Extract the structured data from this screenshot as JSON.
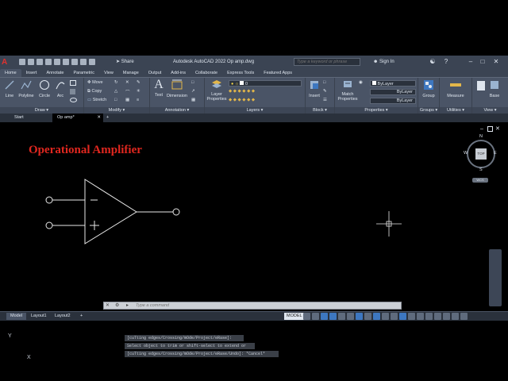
{
  "app": {
    "title": "Autodesk AutoCAD 2022    Op amp.dwg",
    "share_label": "Share",
    "search_placeholder": "Type a keyword or phrase",
    "signin_label": "Sign In",
    "logo_letter": "A"
  },
  "menu": {
    "tabs": [
      "Home",
      "Insert",
      "Annotate",
      "Parametric",
      "View",
      "Manage",
      "Output",
      "Add-ins",
      "Collaborate",
      "Express Tools",
      "Featured Apps"
    ]
  },
  "ribbon": {
    "draw": {
      "title": "Draw",
      "line": "Line",
      "polyline": "Polyline",
      "circle": "Circle",
      "arc": "Arc"
    },
    "modify": {
      "title": "Modify",
      "move": "Move",
      "copy": "Copy",
      "stretch": "Stretch"
    },
    "annotation": {
      "title": "Annotation",
      "text": "Text",
      "dimension": "Dimension"
    },
    "layers": {
      "title": "Layers",
      "layer_properties_1": "Layer",
      "layer_properties_2": "Properties",
      "current_layer": "0"
    },
    "block": {
      "title": "Block",
      "insert": "Insert"
    },
    "properties": {
      "title": "Properties",
      "match_1": "Match",
      "match_2": "Properties",
      "bylayer_color": "ByLayer",
      "bylayer_linetype": "ByLayer",
      "bylayer_lineweight": "ByLayer"
    },
    "groups": {
      "title": "Groups",
      "group": "Group"
    },
    "utilities": {
      "title": "Utilities",
      "measure": "Measure"
    },
    "clipboard": {
      "paste_label": "Base"
    },
    "view": {
      "title": "View"
    }
  },
  "file_tabs": {
    "start": "Start",
    "current": "Op amp*",
    "add": "+"
  },
  "drawing": {
    "title": "Operational Amplifier",
    "title_color": "#e0271f",
    "minus_sign": "−",
    "plus_sign": "+"
  },
  "viewcube": {
    "north": "N",
    "south": "S",
    "east": "E",
    "west": "W",
    "face": "TOP",
    "wcs": "WCS"
  },
  "ucs": {
    "x_label": "X",
    "y_label": "Y"
  },
  "command_history": [
    "[cuTting edges/Crossing/mOde/Project/eRase]:",
    "Select object to trim or shift-select to extend or",
    "[cuTting edges/Crossing/mOde/Project/eRase/Undo]: *Cancel*"
  ],
  "command_line": {
    "placeholder": "Type a command"
  },
  "status": {
    "model_tab": "Model",
    "layout1": "Layout1",
    "layout2": "Layout2",
    "add_layout": "+",
    "model_button": "MODEL"
  },
  "colors": {
    "ribbon_bg": "#4a5466",
    "titlebar_bg": "#3b4453",
    "accent": "#3d77c0"
  }
}
